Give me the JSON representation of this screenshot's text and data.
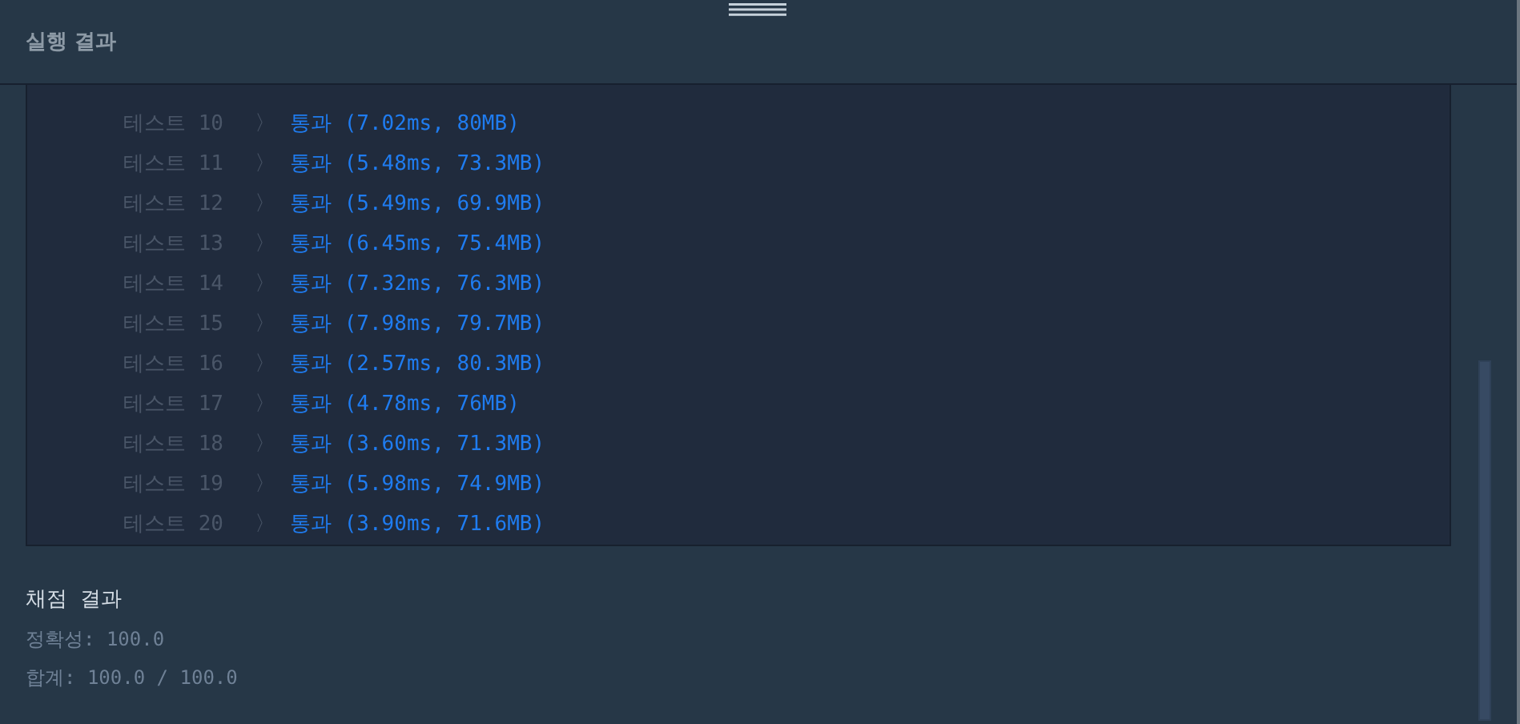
{
  "header": {
    "title": "실행 결과"
  },
  "tests": [
    {
      "label": "테스트 10",
      "separator": "〉",
      "result": "통과 (7.02ms, 80MB)"
    },
    {
      "label": "테스트 11",
      "separator": "〉",
      "result": "통과 (5.48ms, 73.3MB)"
    },
    {
      "label": "테스트 12",
      "separator": "〉",
      "result": "통과 (5.49ms, 69.9MB)"
    },
    {
      "label": "테스트 13",
      "separator": "〉",
      "result": "통과 (6.45ms, 75.4MB)"
    },
    {
      "label": "테스트 14",
      "separator": "〉",
      "result": "통과 (7.32ms, 76.3MB)"
    },
    {
      "label": "테스트 15",
      "separator": "〉",
      "result": "통과 (7.98ms, 79.7MB)"
    },
    {
      "label": "테스트 16",
      "separator": "〉",
      "result": "통과 (2.57ms, 80.3MB)"
    },
    {
      "label": "테스트 17",
      "separator": "〉",
      "result": "통과 (4.78ms, 76MB)"
    },
    {
      "label": "테스트 18",
      "separator": "〉",
      "result": "통과 (3.60ms, 71.3MB)"
    },
    {
      "label": "테스트 19",
      "separator": "〉",
      "result": "통과 (5.98ms, 74.9MB)"
    },
    {
      "label": "테스트 20",
      "separator": "〉",
      "result": "통과 (3.90ms, 71.6MB)"
    }
  ],
  "grading": {
    "title": "채점 결과",
    "lines": [
      "정확성: 100.0",
      "합계: 100.0 / 100.0"
    ]
  }
}
